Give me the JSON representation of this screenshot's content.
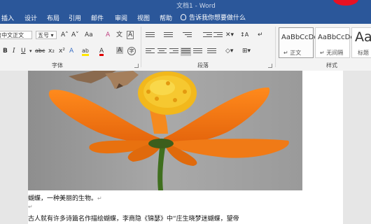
{
  "titlebar": {
    "title": "文档1 - Word"
  },
  "tabs": [
    {
      "label": "插入"
    },
    {
      "label": "设计"
    },
    {
      "label": "布局"
    },
    {
      "label": "引用"
    },
    {
      "label": "邮件"
    },
    {
      "label": "审阅"
    },
    {
      "label": "视图"
    },
    {
      "label": "帮助"
    }
  ],
  "tell_me": "告诉我你想要做什么",
  "ribbon": {
    "font": {
      "name": "(中文正文",
      "size": "五号",
      "grow": "A˄",
      "shrink": "A˅",
      "change_case": "Aa",
      "clear": "A",
      "phonetic": "文",
      "border_char": "A",
      "bold": "B",
      "italic": "I",
      "underline": "U",
      "strike": "abc",
      "subscript": "x₂",
      "superscript": "x²",
      "effects": "A",
      "highlight": "ab",
      "font_color": "A",
      "shading": "A",
      "enclose": "字",
      "group_label": "字体"
    },
    "paragraph": {
      "group_label": "段落",
      "sort": "↕A",
      "marks": "↵"
    },
    "styles": {
      "items": [
        {
          "sample": "AaBbCcDc",
          "name": "↵ 正文"
        },
        {
          "sample": "AaBbCcDc",
          "name": "↵ 无间隔"
        },
        {
          "sample": "Aa",
          "name": "标题"
        }
      ],
      "group_label": "样式"
    }
  },
  "document": {
    "line1": "蝴蝶，一种美丽的生物。",
    "line3": "古人就有许多诗篇名作描绘蝴蝶，李商隐《锦瑟》中“庄生晓梦迷蝴蝶，望帝",
    "para_mark": "↵"
  },
  "colors": {
    "ribbon_blue": "#2b579a",
    "petal": "#f47d1a",
    "flower_center": "#f2b81c",
    "highlight": "#ffe600",
    "font_color_bar": "#e00000"
  }
}
